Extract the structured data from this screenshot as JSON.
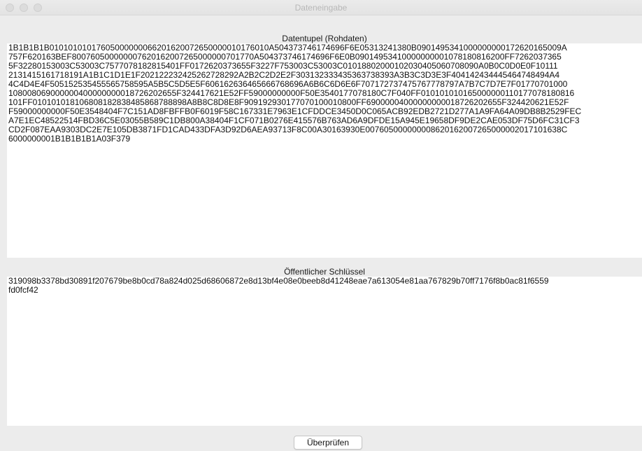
{
  "window": {
    "title": "Dateneingabe"
  },
  "raw_data": {
    "label": "Datentupel (Rohdaten)",
    "lines": [
      "1B1B1B1B0101010101760500000006620162007265000001017601 0A504373746174696F6E05313241380B0901495341000000000172620165009A",
      "757F620163BEF80076050000000762016200726500000070177 0A504373746174696F6E0B0901495341000000000107818 0816200FF7262037365",
      "5F32280153003C53003C7577078182815401FF0172620373655F3227F753003C53003C01018802000102030405060708090A0B0C0D0E0F10111",
      "2131415161718191A1B1C1D1E1F2021222324252627282 92A2B2C2D2E2F3031323334353637383 93A3B3C3D3E3F404142434445464748494A4",
      "4C4D4E4F505152535455565758595A5B5C5D5E5F606162636465666768696A6B6C6D6E6F70717273747576777879 7A7B7C7D7E7F01770701000",
      "1080080690000004000000000187262 02655F324417621E52FF59000000000F50E3540177078180C7F040FF010101010165000000110177078180816",
      "101FF010101018106808182838485868788898A8B8C8D8E8F909192930177070100010800FF690000040000000000187262 02655F324420621E52F",
      "F59000000000F50E3548404F7C151AD8FBFFB0F6019F58C167331E7963E1CFDDCE3450D0C065ACB92EDB2721D277A1A9FA64A09DB8B2529FEC",
      "A7E1EC48522514FBD36C5E03055B589C1DB800A38404F1CF071B0276E415576B763AD6A9DFDE15A945E19658DF9DE2CAE053DF75D6FC31CF3",
      "CD2F087EAA9303DC2E7E105DB3871FD1CAD433DFA3D92D6AEA93713F8C00A30163930E007605000000008620162007265000002017101638C",
      "6000000001B1B1B1B1A03F379"
    ]
  },
  "public_key": {
    "label": "Öffentlicher Schlüssel",
    "lines": [
      "319098b3378bd30891f207679be8b0cd78a824d025d68606872e8d13bf4e08e0beeb8d41248eae7a613054e81aa767829b70ff7176f8b0ac81f6559",
      "fd0fcf42"
    ]
  },
  "actions": {
    "verify_label": "Überprüfen"
  }
}
